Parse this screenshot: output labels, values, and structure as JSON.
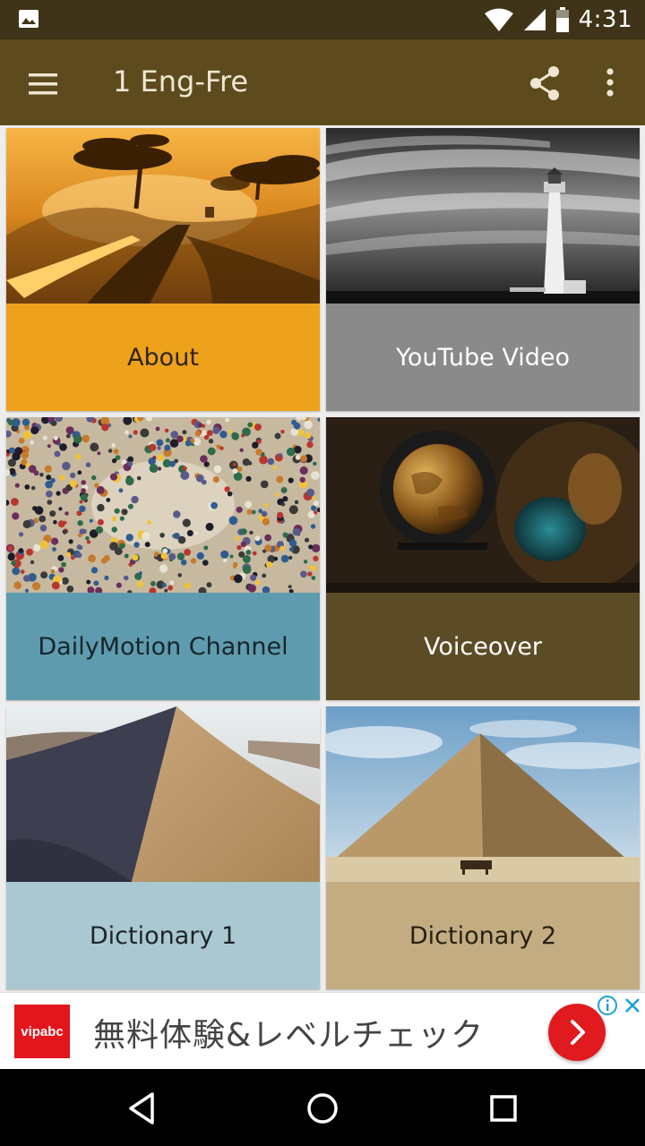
{
  "status_bar": {
    "time": "4:31",
    "icons": [
      "gallery-icon",
      "wifi-icon",
      "signal-icon",
      "battery-icon"
    ]
  },
  "app_bar": {
    "title": "1 Eng-Fre",
    "icons": [
      "menu-icon",
      "share-icon",
      "more-vert-icon"
    ],
    "color": "#5d4b1e"
  },
  "tiles": [
    {
      "label": "About",
      "color": "#eea11b",
      "text_color": "#2e2410"
    },
    {
      "label": "YouTube Video",
      "color": "#8a8a8a",
      "text_color": "#ffffff"
    },
    {
      "label": "DailyMotion Channel",
      "color": "#5f9bae",
      "text_color": "#16252b"
    },
    {
      "label": "Voiceover",
      "color": "#5b4c25",
      "text_color": "#ffffff"
    },
    {
      "label": "Dictionary 1",
      "color": "#a9c8d2",
      "text_color": "#1d2427"
    },
    {
      "label": "Dictionary 2",
      "color": "#c3ac82",
      "text_color": "#27200f"
    }
  ],
  "ad": {
    "brand": "vipabc",
    "text": "無料体験&レベルチェック",
    "icons": [
      "chevron-right-icon",
      "info-icon",
      "close-icon"
    ]
  },
  "nav_bar": {
    "icons": [
      "back-icon",
      "home-icon",
      "recents-icon"
    ]
  }
}
